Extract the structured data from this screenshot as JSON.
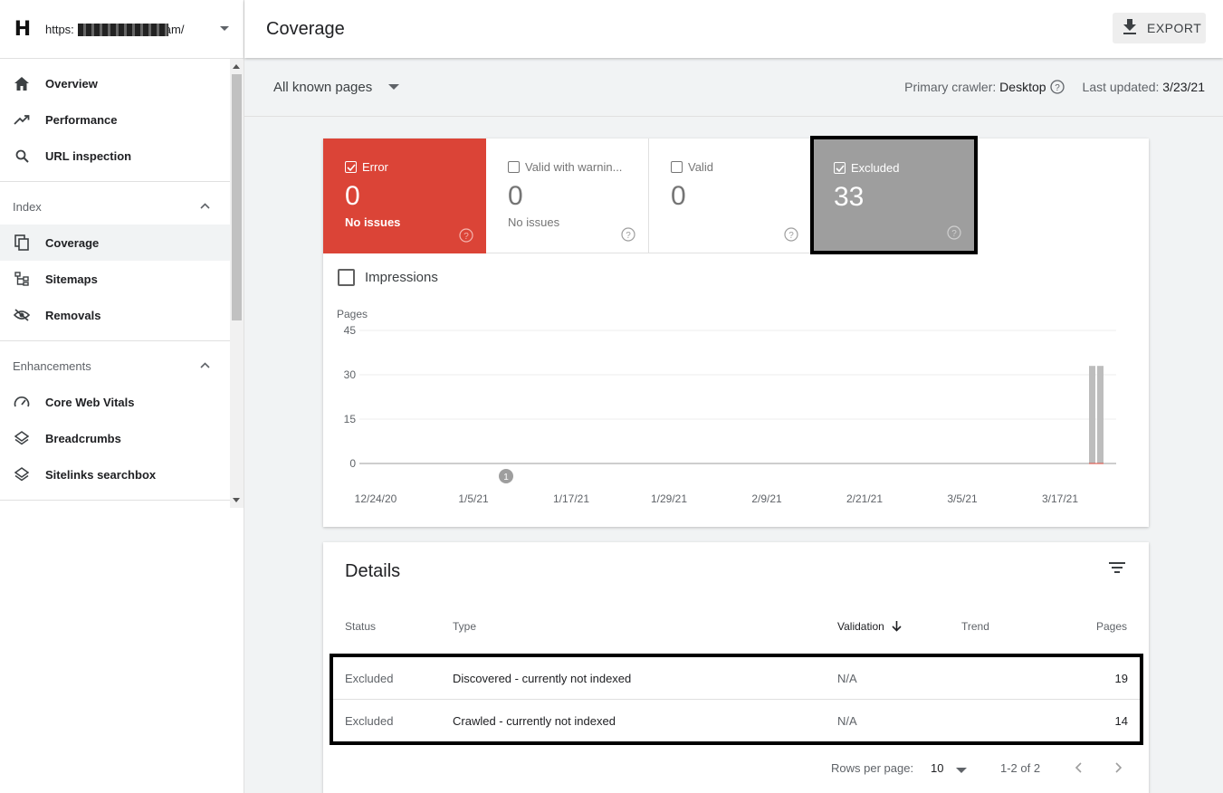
{
  "property": {
    "url_prefix": "https:",
    "url_suffix": "am/"
  },
  "sidebar": {
    "items": [
      {
        "label": "Overview",
        "icon": "home-icon"
      },
      {
        "label": "Performance",
        "icon": "trending-up-icon"
      },
      {
        "label": "URL inspection",
        "icon": "search-icon"
      }
    ],
    "index_section": "Index",
    "index_items": [
      {
        "label": "Coverage",
        "icon": "coverage-icon"
      },
      {
        "label": "Sitemaps",
        "icon": "sitemap-icon"
      },
      {
        "label": "Removals",
        "icon": "eye-off-icon"
      }
    ],
    "enh_section": "Enhancements",
    "enh_items": [
      {
        "label": "Core Web Vitals",
        "icon": "speed-icon"
      },
      {
        "label": "Breadcrumbs",
        "icon": "layers-icon"
      },
      {
        "label": "Sitelinks searchbox",
        "icon": "layers-icon"
      }
    ]
  },
  "header": {
    "title": "Coverage",
    "export_label": "EXPORT"
  },
  "filter": {
    "pages_select": "All known pages",
    "crawler_label": "Primary crawler:",
    "crawler_value": "Desktop",
    "updated_label": "Last updated:",
    "updated_value": "3/23/21"
  },
  "tiles": {
    "error": {
      "label": "Error",
      "value": "0",
      "sub": "No issues",
      "color": "#db4437"
    },
    "warn": {
      "label": "Valid with warnin...",
      "value": "0",
      "sub": "No issues"
    },
    "valid": {
      "label": "Valid",
      "value": "0"
    },
    "excluded": {
      "label": "Excluded",
      "value": "33",
      "color": "#9e9e9e"
    }
  },
  "impressions_label": "Impressions",
  "chart_data": {
    "type": "bar",
    "ylabel": "Pages",
    "ylim": [
      0,
      45
    ],
    "yticks": [
      "45",
      "30",
      "15",
      "0"
    ],
    "xticks": [
      "12/24/20",
      "1/5/21",
      "1/17/21",
      "1/29/21",
      "2/9/21",
      "2/21/21",
      "3/5/21",
      "3/17/21"
    ],
    "annotation": "1",
    "series": [
      {
        "name": "Excluded",
        "color": "#bdbdbd",
        "values": [
          {
            "x": "3/22/21",
            "y": 33
          },
          {
            "x": "3/23/21",
            "y": 33
          }
        ]
      }
    ],
    "grid": true
  },
  "details": {
    "title": "Details",
    "columns": {
      "status": "Status",
      "type": "Type",
      "validation": "Validation",
      "trend": "Trend",
      "pages": "Pages"
    },
    "rows": [
      {
        "status": "Excluded",
        "type": "Discovered - currently not indexed",
        "validation": "N/A",
        "pages": "19"
      },
      {
        "status": "Excluded",
        "type": "Crawled - currently not indexed",
        "validation": "N/A",
        "pages": "14"
      }
    ],
    "rows_per_page_label": "Rows per page:",
    "rows_per_page": "10",
    "range": "1-2 of 2"
  }
}
